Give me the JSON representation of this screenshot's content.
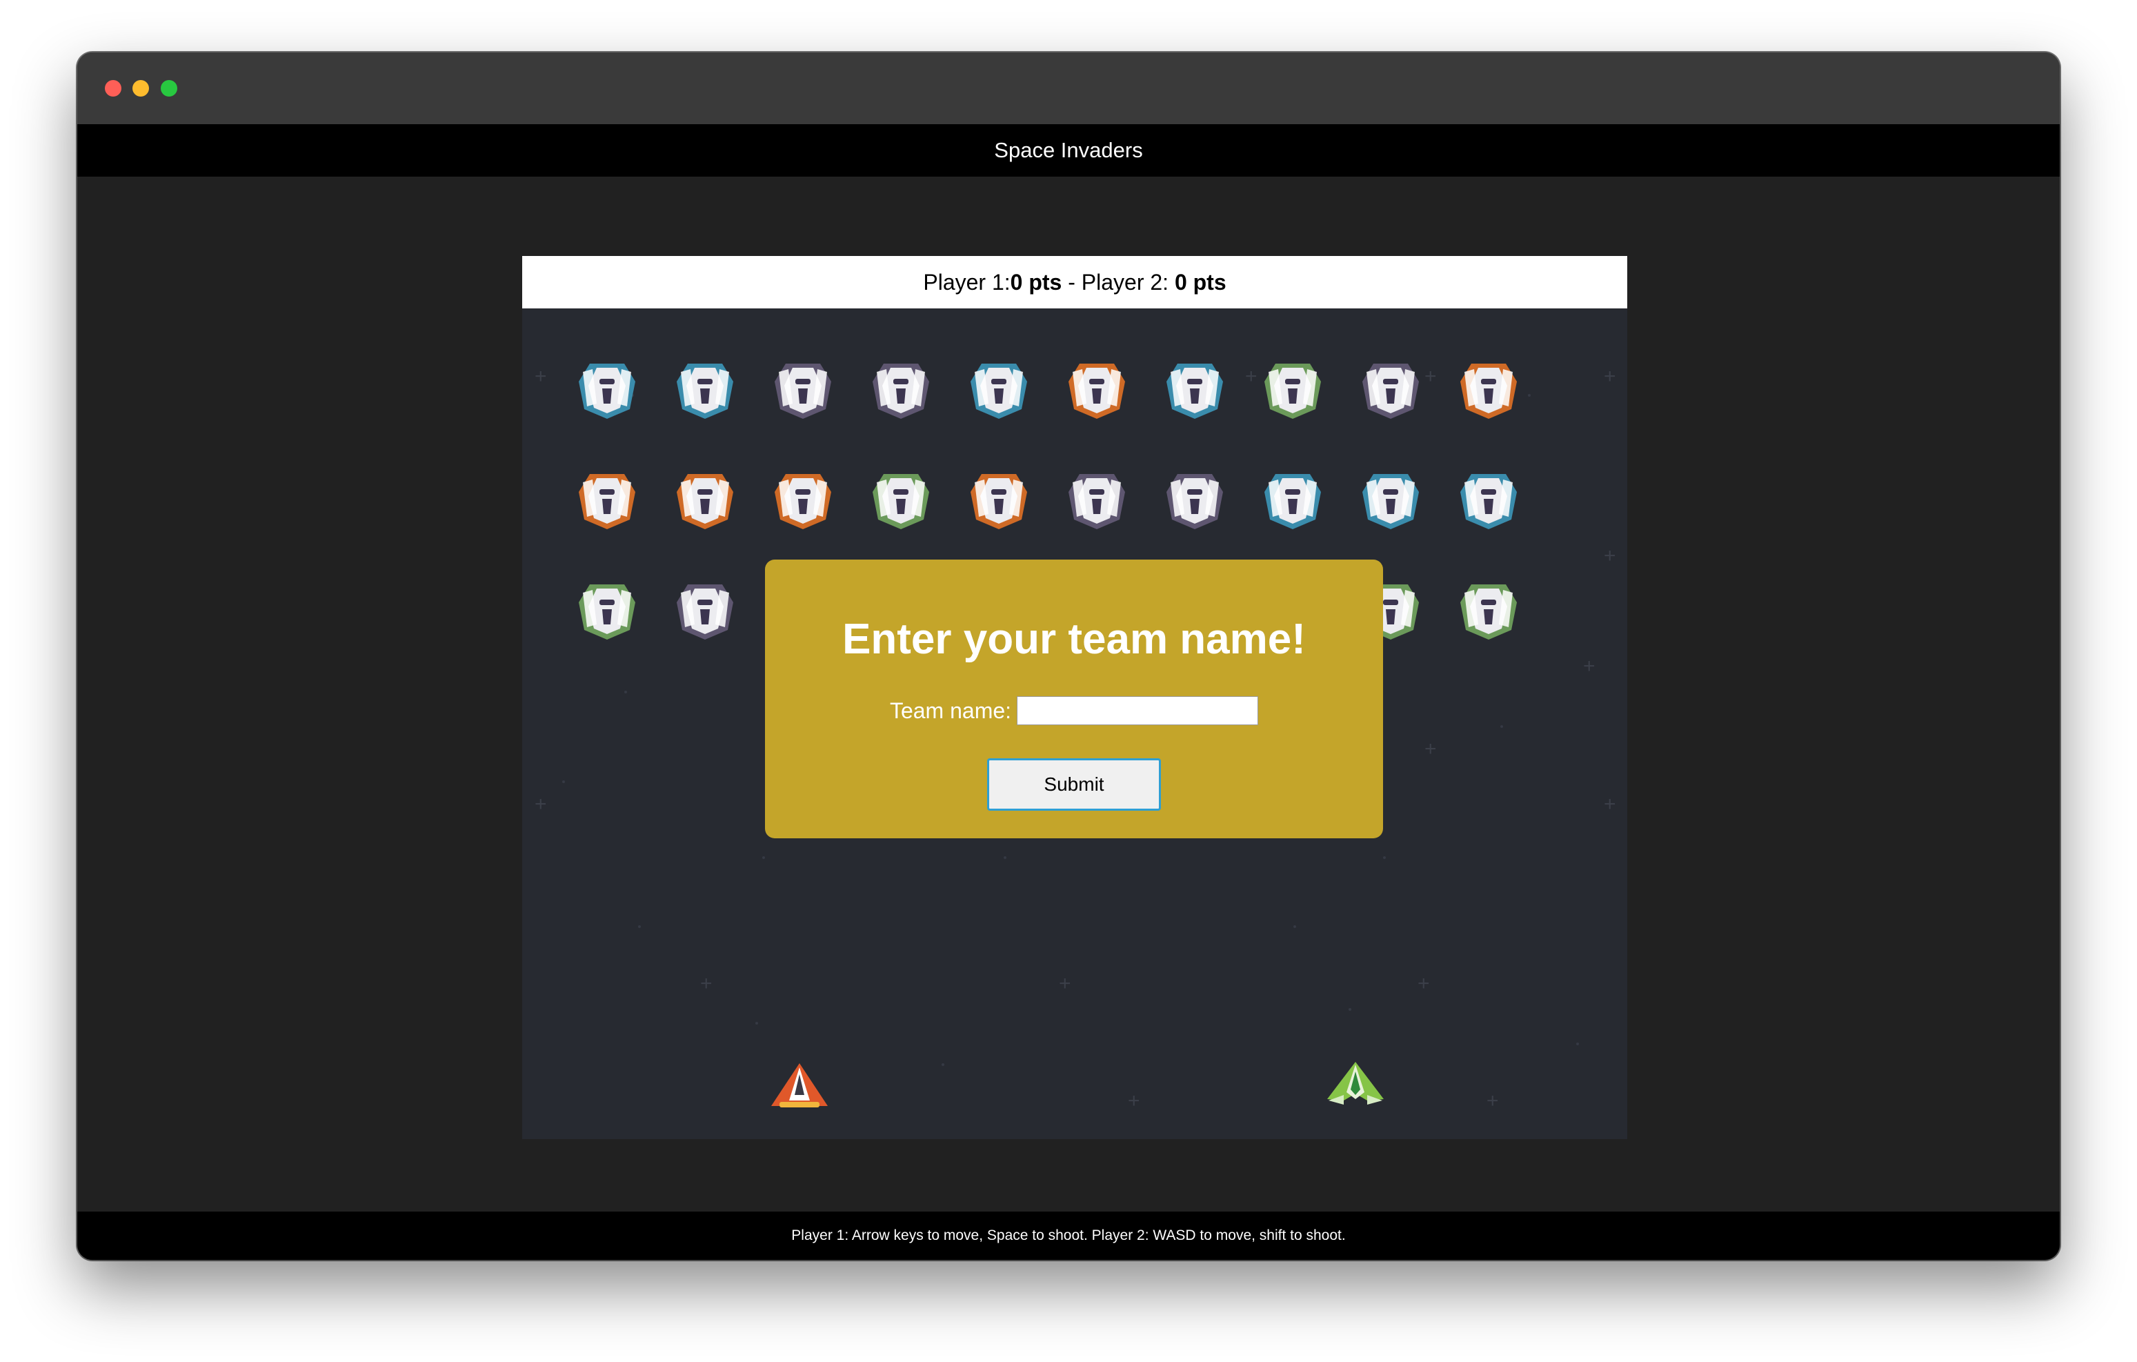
{
  "window": {
    "traffic_lights": [
      "close",
      "minimize",
      "zoom"
    ]
  },
  "app": {
    "title": "Space Invaders"
  },
  "scoreboard": {
    "p1_label": "Player 1: ",
    "p1_score": "0 pts",
    "separator": " - Player 2: ",
    "p2_score": "0 pts"
  },
  "invaders": {
    "rows": [
      [
        "blue",
        "blue",
        "purple",
        "purple",
        "blue",
        "orange",
        "blue",
        "green",
        "purple",
        "orange"
      ],
      [
        "orange",
        "orange",
        "orange",
        "green",
        "orange",
        "purple",
        "purple",
        "blue",
        "blue",
        "blue"
      ],
      [
        "green",
        "purple",
        "",
        "",
        "",
        "",
        "",
        "",
        "green",
        "green"
      ]
    ],
    "colors": {
      "blue": "#3a8cac",
      "orange": "#cf6a26",
      "purple": "#5e5670",
      "green": "#6b9a5a"
    }
  },
  "players": [
    {
      "name": "player-1-ship",
      "color": "#e0582a"
    },
    {
      "name": "player-2-ship",
      "color": "#86c447"
    }
  ],
  "modal": {
    "heading": "Enter your team name!",
    "team_label": "Team name:",
    "team_value": "",
    "team_placeholder": "",
    "submit_label": "Submit",
    "background": "#c4a52a"
  },
  "footer": {
    "instructions": "Player 1: Arrow keys to move, Space to shoot. Player 2: WASD to move, shift to shoot."
  }
}
